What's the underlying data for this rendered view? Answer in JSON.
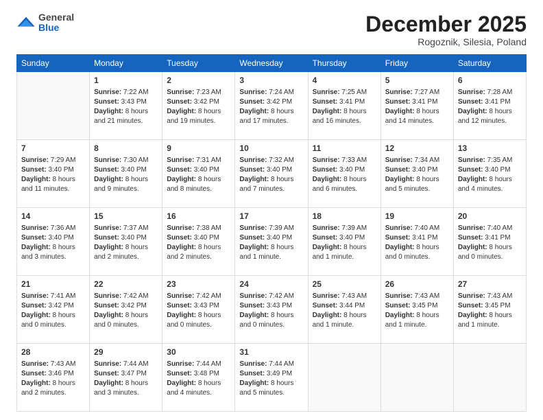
{
  "logo": {
    "general": "General",
    "blue": "Blue"
  },
  "title": "December 2025",
  "location": "Rogoznik, Silesia, Poland",
  "days_of_week": [
    "Sunday",
    "Monday",
    "Tuesday",
    "Wednesday",
    "Thursday",
    "Friday",
    "Saturday"
  ],
  "weeks": [
    [
      {
        "day": "",
        "empty": true
      },
      {
        "day": "1",
        "sunrise": "7:22 AM",
        "sunset": "3:43 PM",
        "daylight": "8 hours and 21 minutes."
      },
      {
        "day": "2",
        "sunrise": "7:23 AM",
        "sunset": "3:42 PM",
        "daylight": "8 hours and 19 minutes."
      },
      {
        "day": "3",
        "sunrise": "7:24 AM",
        "sunset": "3:42 PM",
        "daylight": "8 hours and 17 minutes."
      },
      {
        "day": "4",
        "sunrise": "7:25 AM",
        "sunset": "3:41 PM",
        "daylight": "8 hours and 16 minutes."
      },
      {
        "day": "5",
        "sunrise": "7:27 AM",
        "sunset": "3:41 PM",
        "daylight": "8 hours and 14 minutes."
      },
      {
        "day": "6",
        "sunrise": "7:28 AM",
        "sunset": "3:41 PM",
        "daylight": "8 hours and 12 minutes."
      }
    ],
    [
      {
        "day": "7",
        "sunrise": "7:29 AM",
        "sunset": "3:40 PM",
        "daylight": "8 hours and 11 minutes."
      },
      {
        "day": "8",
        "sunrise": "7:30 AM",
        "sunset": "3:40 PM",
        "daylight": "8 hours and 9 minutes."
      },
      {
        "day": "9",
        "sunrise": "7:31 AM",
        "sunset": "3:40 PM",
        "daylight": "8 hours and 8 minutes."
      },
      {
        "day": "10",
        "sunrise": "7:32 AM",
        "sunset": "3:40 PM",
        "daylight": "8 hours and 7 minutes."
      },
      {
        "day": "11",
        "sunrise": "7:33 AM",
        "sunset": "3:40 PM",
        "daylight": "8 hours and 6 minutes."
      },
      {
        "day": "12",
        "sunrise": "7:34 AM",
        "sunset": "3:40 PM",
        "daylight": "8 hours and 5 minutes."
      },
      {
        "day": "13",
        "sunrise": "7:35 AM",
        "sunset": "3:40 PM",
        "daylight": "8 hours and 4 minutes."
      }
    ],
    [
      {
        "day": "14",
        "sunrise": "7:36 AM",
        "sunset": "3:40 PM",
        "daylight": "8 hours and 3 minutes."
      },
      {
        "day": "15",
        "sunrise": "7:37 AM",
        "sunset": "3:40 PM",
        "daylight": "8 hours and 2 minutes."
      },
      {
        "day": "16",
        "sunrise": "7:38 AM",
        "sunset": "3:40 PM",
        "daylight": "8 hours and 2 minutes."
      },
      {
        "day": "17",
        "sunrise": "7:39 AM",
        "sunset": "3:40 PM",
        "daylight": "8 hours and 1 minute."
      },
      {
        "day": "18",
        "sunrise": "7:39 AM",
        "sunset": "3:40 PM",
        "daylight": "8 hours and 1 minute."
      },
      {
        "day": "19",
        "sunrise": "7:40 AM",
        "sunset": "3:41 PM",
        "daylight": "8 hours and 0 minutes."
      },
      {
        "day": "20",
        "sunrise": "7:40 AM",
        "sunset": "3:41 PM",
        "daylight": "8 hours and 0 minutes."
      }
    ],
    [
      {
        "day": "21",
        "sunrise": "7:41 AM",
        "sunset": "3:42 PM",
        "daylight": "8 hours and 0 minutes."
      },
      {
        "day": "22",
        "sunrise": "7:42 AM",
        "sunset": "3:42 PM",
        "daylight": "8 hours and 0 minutes."
      },
      {
        "day": "23",
        "sunrise": "7:42 AM",
        "sunset": "3:43 PM",
        "daylight": "8 hours and 0 minutes."
      },
      {
        "day": "24",
        "sunrise": "7:42 AM",
        "sunset": "3:43 PM",
        "daylight": "8 hours and 0 minutes."
      },
      {
        "day": "25",
        "sunrise": "7:43 AM",
        "sunset": "3:44 PM",
        "daylight": "8 hours and 1 minute."
      },
      {
        "day": "26",
        "sunrise": "7:43 AM",
        "sunset": "3:45 PM",
        "daylight": "8 hours and 1 minute."
      },
      {
        "day": "27",
        "sunrise": "7:43 AM",
        "sunset": "3:45 PM",
        "daylight": "8 hours and 1 minute."
      }
    ],
    [
      {
        "day": "28",
        "sunrise": "7:43 AM",
        "sunset": "3:46 PM",
        "daylight": "8 hours and 2 minutes."
      },
      {
        "day": "29",
        "sunrise": "7:44 AM",
        "sunset": "3:47 PM",
        "daylight": "8 hours and 3 minutes."
      },
      {
        "day": "30",
        "sunrise": "7:44 AM",
        "sunset": "3:48 PM",
        "daylight": "8 hours and 4 minutes."
      },
      {
        "day": "31",
        "sunrise": "7:44 AM",
        "sunset": "3:49 PM",
        "daylight": "8 hours and 5 minutes."
      },
      {
        "day": "",
        "empty": true
      },
      {
        "day": "",
        "empty": true
      },
      {
        "day": "",
        "empty": true
      }
    ]
  ],
  "labels": {
    "sunrise": "Sunrise:",
    "sunset": "Sunset:",
    "daylight": "Daylight:"
  }
}
